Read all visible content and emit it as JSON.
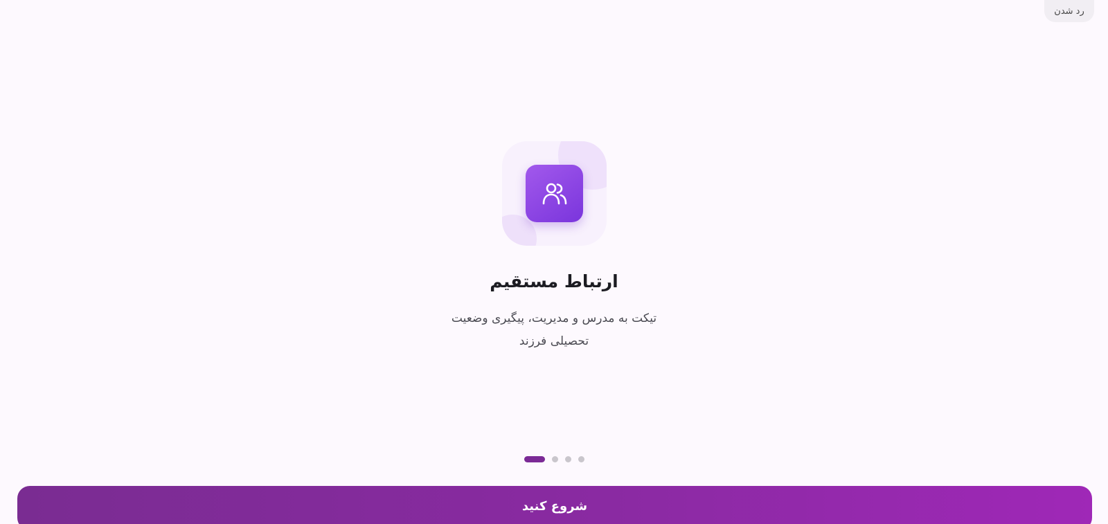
{
  "header": {
    "skip_label": "رد شدن"
  },
  "slide": {
    "icon": "users-icon",
    "title": "ارتباط مستقیم",
    "description_line1": "تیکت به مدرس و مدیریت، پیگیری وضعیت",
    "description_line2": "تحصیلی فرزند"
  },
  "pagination": {
    "total": 4,
    "active_index": 0
  },
  "footer": {
    "cta_label": "شروع کنید"
  },
  "colors": {
    "accent": "#7b2a96",
    "icon_tile": "#8b45e4",
    "background": "#fdf9fe"
  }
}
